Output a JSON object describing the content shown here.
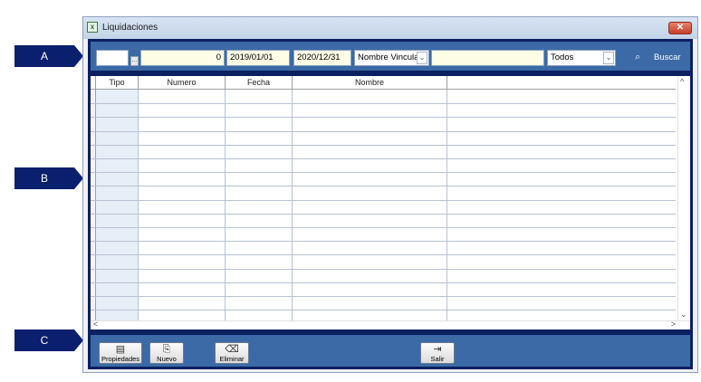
{
  "window": {
    "title": "Liquidaciones",
    "close_glyph": "✕"
  },
  "callouts": {
    "a": "A",
    "b": "B",
    "c": "C"
  },
  "filters": {
    "code": "",
    "code_button": "...",
    "number": "0",
    "date_from": "2019/01/01",
    "date_to": "2020/12/31",
    "field_select": "Nombre Vincula",
    "search_text": "",
    "status_select": "Todos",
    "search_label": "Buscar"
  },
  "grid": {
    "columns": [
      "Tipo",
      "Numero",
      "Fecha",
      "Nombre"
    ],
    "rows": []
  },
  "toolbar": {
    "properties_label": "Propiedades",
    "new_label": "Nuevo",
    "delete_label": "Eliminar",
    "exit_label": "Salir"
  },
  "icons": {
    "app": "spreadsheet-icon",
    "search": "search-icon",
    "properties": "properties-icon",
    "new": "new-document-icon",
    "delete": "eraser-icon",
    "exit": "exit-icon"
  },
  "colors": {
    "panel": "#3b6aa6",
    "panel_border": "#0a2060",
    "field_bg": "#fdfde6",
    "callout": "#0a1f6e"
  }
}
